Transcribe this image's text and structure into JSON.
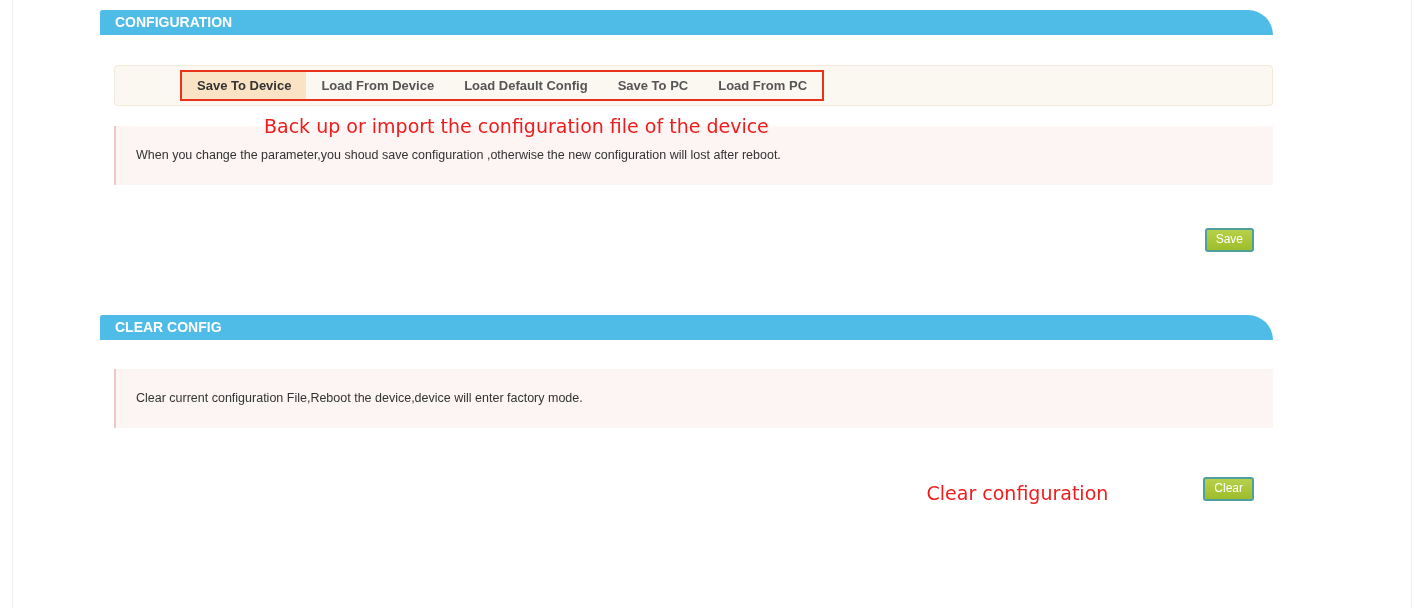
{
  "sections": [
    {
      "title": "CONFIGURATION",
      "tabs": [
        {
          "label": "Save To Device",
          "selected": true
        },
        {
          "label": "Load From Device",
          "selected": false
        },
        {
          "label": "Load Default Config",
          "selected": false
        },
        {
          "label": "Save To PC",
          "selected": false
        },
        {
          "label": "Load From PC",
          "selected": false
        }
      ],
      "annotation": "Back up or import the configuration file of the device",
      "note": "When you change the parameter,you shoud save configuration ,otherwise the new configuration will lost after reboot.",
      "button": {
        "label": "Save"
      }
    },
    {
      "title": "CLEAR CONFIG",
      "note": "Clear current configuration File,Reboot the device,device will enter factory mode.",
      "button": {
        "label": "Clear",
        "annotation": "Clear configuration"
      }
    }
  ]
}
